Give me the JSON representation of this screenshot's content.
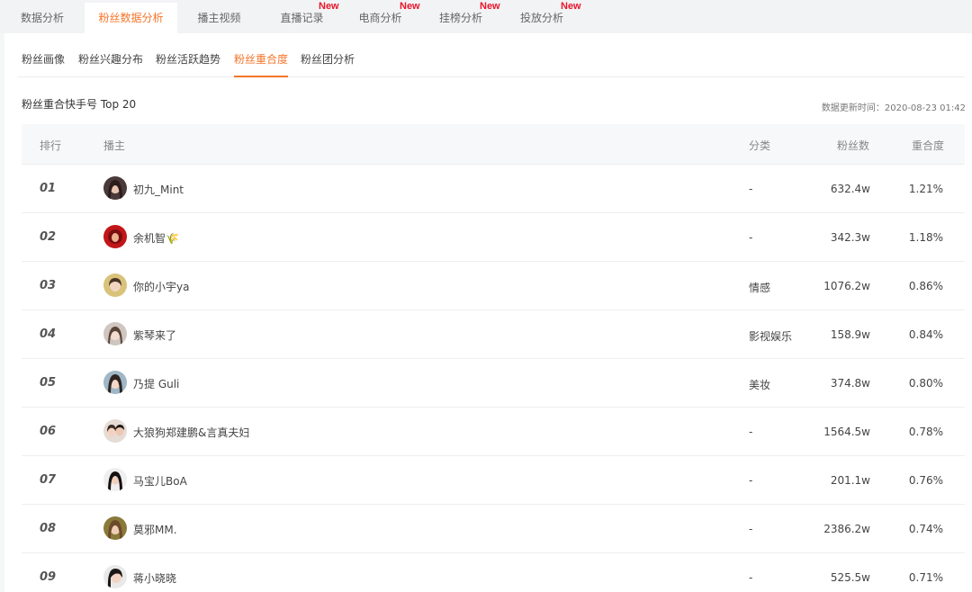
{
  "top_tabs": [
    {
      "label": "数据分析",
      "active": false,
      "new": false
    },
    {
      "label": "粉丝数据分析",
      "active": true,
      "new": false
    },
    {
      "label": "播主视频",
      "active": false,
      "new": false
    },
    {
      "label": "直播记录",
      "active": false,
      "new": true
    },
    {
      "label": "电商分析",
      "active": false,
      "new": true
    },
    {
      "label": "挂榜分析",
      "active": false,
      "new": true
    },
    {
      "label": "投放分析",
      "active": false,
      "new": true
    }
  ],
  "new_badge": "New",
  "sub_tabs": [
    {
      "label": "粉丝画像",
      "active": false
    },
    {
      "label": "粉丝兴趣分布",
      "active": false
    },
    {
      "label": "粉丝活跃趋势",
      "active": false
    },
    {
      "label": "粉丝重合度",
      "active": true
    },
    {
      "label": "粉丝团分析",
      "active": false
    }
  ],
  "section_title": "粉丝重合快手号 Top 20",
  "update_time": "数据更新时间：2020-08-23 01:42",
  "table": {
    "headers": {
      "rank": "排行",
      "streamer": "播主",
      "category": "分类",
      "fans": "粉丝数",
      "overlap": "重合度"
    },
    "rows": [
      {
        "rank": "01",
        "name": "初九_Mint",
        "category": "-",
        "fans": "632.4w",
        "overlap": "1.21%"
      },
      {
        "rank": "02",
        "name": "余机智🌾",
        "category": "-",
        "fans": "342.3w",
        "overlap": "1.18%"
      },
      {
        "rank": "03",
        "name": "你的小宇ya",
        "category": "情感",
        "fans": "1076.2w",
        "overlap": "0.86%"
      },
      {
        "rank": "04",
        "name": "紫琴来了",
        "category": "影视娱乐",
        "fans": "158.9w",
        "overlap": "0.84%"
      },
      {
        "rank": "05",
        "name": "乃提 Guli",
        "category": "美妆",
        "fans": "374.8w",
        "overlap": "0.80%"
      },
      {
        "rank": "06",
        "name": "大狼狗郑建鹏&言真夫妇",
        "category": "-",
        "fans": "1564.5w",
        "overlap": "0.78%"
      },
      {
        "rank": "07",
        "name": "马宝儿BoA",
        "category": "-",
        "fans": "201.1w",
        "overlap": "0.76%"
      },
      {
        "rank": "08",
        "name": "莫邪MM.",
        "category": "-",
        "fans": "2386.2w",
        "overlap": "0.74%"
      },
      {
        "rank": "09",
        "name": "蒋小晓晓",
        "category": "-",
        "fans": "525.5w",
        "overlap": "0.71%"
      }
    ]
  },
  "colors": {
    "accent": "#f5752a",
    "new_badge": "#e8162b"
  }
}
